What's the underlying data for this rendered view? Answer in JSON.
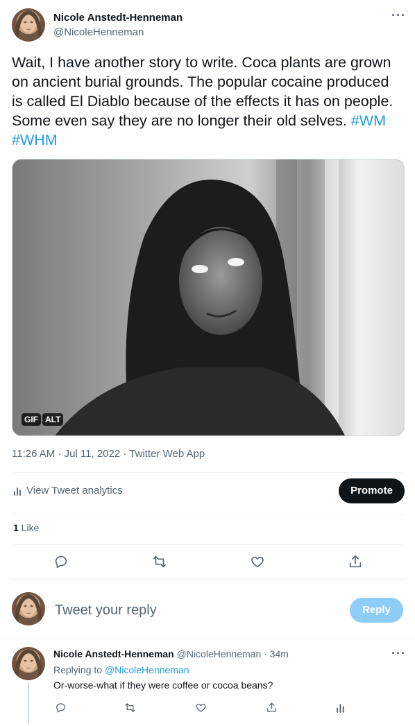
{
  "tweet": {
    "author_name": "Nicole Anstedt-Henneman",
    "author_handle": "@NicoleHenneman",
    "more_label": "···",
    "text": "Wait, I have another story to write. Coca plants are grown on ancient burial grounds. The popular cocaine produced is called El Diablo because of the effects it has on people. Some even say they are no longer their old selves. ",
    "hashtags": [
      "#WM",
      "#WHM"
    ],
    "media": {
      "badge_gif": "GIF",
      "badge_alt": "ALT"
    },
    "timestamp": "11:26 AM · Jul 11, 2022 · Twitter Web App"
  },
  "analytics": {
    "label": "View Tweet analytics",
    "icon": "analytics-icon",
    "promote_label": "Promote"
  },
  "stats": {
    "like_count": "1",
    "like_label": " Like"
  },
  "actions": [
    "reply-icon",
    "retweet-icon",
    "like-icon",
    "share-icon"
  ],
  "composer": {
    "placeholder": "Tweet your reply",
    "reply_label": "Reply"
  },
  "reply": {
    "author_name": "Nicole Anstedt-Henneman",
    "author_handle": "@NicoleHenneman",
    "time": " · 34m",
    "replying_to_label": "Replying to ",
    "replying_to_handle": "@NicoleHenneman",
    "text": "Or-worse-what if they were coffee or cocoa beans?",
    "more_label": "···"
  },
  "colors": {
    "accent": "#1d9bf0",
    "text": "#0f1419",
    "muted": "#536471",
    "reply_button": "#8ecdf8"
  }
}
